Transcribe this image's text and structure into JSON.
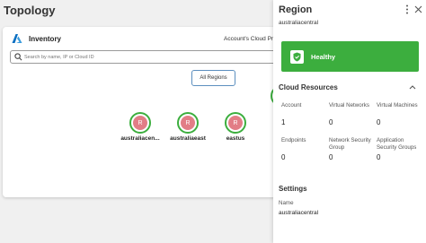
{
  "page": {
    "title": "Topology"
  },
  "inventory": {
    "title": "Inventory",
    "account_label": "Account's Cloud Pr",
    "search": {
      "placeholder": "Search by name, IP or Cloud ID",
      "value": ""
    },
    "all_regions_label": "All Regions",
    "regions": [
      {
        "name": "australiacen...",
        "initial": "R"
      },
      {
        "name": "australiaeast",
        "initial": "R"
      },
      {
        "name": "eastus",
        "initial": "R"
      }
    ]
  },
  "panel": {
    "title": "Region",
    "subtitle": "australiacentral",
    "health": {
      "status": "Healthy"
    },
    "cloud_resources": {
      "title": "Cloud Resources",
      "items": [
        {
          "label": "Account",
          "value": "1"
        },
        {
          "label": "Virtual Networks",
          "value": "0"
        },
        {
          "label": "Virtual Machines",
          "value": "0"
        },
        {
          "label": "Endpoints",
          "value": "0"
        },
        {
          "label": "Network Security Group",
          "value": "0"
        },
        {
          "label": "Application Security Groups",
          "value": "0"
        }
      ]
    },
    "settings": {
      "title": "Settings",
      "name_label": "Name",
      "name_value": "australiacentral"
    }
  },
  "colors": {
    "healthy": "#3cae3e",
    "region_node": "#e27d86",
    "accent": "#5c8fbf",
    "azure_blue": "#0078d4"
  }
}
